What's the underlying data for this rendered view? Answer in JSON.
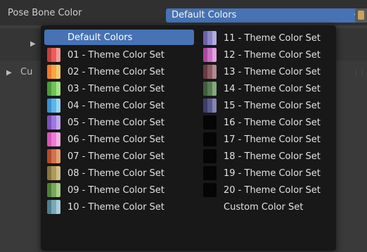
{
  "property": {
    "label": "Pose Bone Color",
    "value": "Default Colors"
  },
  "menu": {
    "left_items": [
      {
        "label": "Default Colors",
        "swatch": null,
        "selected": true
      },
      {
        "label": "01 - Theme Color Set",
        "swatch": [
          "#c0413f",
          "#f05c56",
          "#f29c9c"
        ]
      },
      {
        "label": "02 - Theme Color Set",
        "swatch": [
          "#f07a2a",
          "#f7a643",
          "#f6cc6a"
        ]
      },
      {
        "label": "03 - Theme Color Set",
        "swatch": [
          "#4a9b3a",
          "#6ec35a",
          "#a6e57e"
        ]
      },
      {
        "label": "04 - Theme Color Set",
        "swatch": [
          "#3a8fd0",
          "#5cb6e8",
          "#9ad7f2"
        ]
      },
      {
        "label": "05 - Theme Color Set",
        "swatch": [
          "#7a52b8",
          "#9e78dc",
          "#c4a8ee"
        ]
      },
      {
        "label": "06 - Theme Color Set",
        "swatch": [
          "#d655b8",
          "#ee7cd4",
          "#f6b0e6"
        ]
      },
      {
        "label": "07 - Theme Color Set",
        "swatch": [
          "#b24a2c",
          "#d0744c",
          "#e8a070"
        ]
      },
      {
        "label": "08 - Theme Color Set",
        "swatch": [
          "#8a7440",
          "#b09a58",
          "#d0c08a"
        ]
      },
      {
        "label": "09 - Theme Color Set",
        "swatch": [
          "#4f7e3a",
          "#7aa85a",
          "#a6cf86"
        ]
      },
      {
        "label": "10 - Theme Color Set",
        "swatch": [
          "#4f7e8e",
          "#7aa8b6",
          "#a6cfdb"
        ]
      }
    ],
    "right_items": [
      {
        "label": "11 - Theme Color Set",
        "swatch": [
          "#6a62a8",
          "#8c84c8",
          "#b2acde"
        ]
      },
      {
        "label": "12 - Theme Color Set",
        "swatch": [
          "#a64aa0",
          "#cc70c4",
          "#e2a2dc"
        ]
      },
      {
        "label": "13 - Theme Color Set",
        "swatch": [
          "#6a3a42",
          "#8c5c64",
          "#b08a90"
        ]
      },
      {
        "label": "14 - Theme Color Set",
        "swatch": [
          "#3f5e3a",
          "#5a7c54",
          "#86a67e"
        ]
      },
      {
        "label": "15 - Theme Color Set",
        "swatch": [
          "#3e3e6a",
          "#5a5a8c",
          "#8484b2"
        ]
      },
      {
        "label": "16 - Theme Color Set",
        "swatch": [
          "#050505",
          "#050505",
          "#050505"
        ]
      },
      {
        "label": "17 - Theme Color Set",
        "swatch": [
          "#050505",
          "#050505",
          "#050505"
        ]
      },
      {
        "label": "18 - Theme Color Set",
        "swatch": [
          "#050505",
          "#050505",
          "#050505"
        ]
      },
      {
        "label": "19 - Theme Color Set",
        "swatch": [
          "#050505",
          "#050505",
          "#050505"
        ]
      },
      {
        "label": "20 - Theme Color Set",
        "swatch": [
          "#050505",
          "#050505",
          "#050505"
        ]
      },
      {
        "label": "Custom Color Set",
        "swatch": null
      }
    ]
  },
  "background": {
    "panel_label_fragment": "Cu"
  },
  "colors": {
    "accent": "#4772b3",
    "menu_bg": "#181818",
    "window_bg": "#3d3d3d"
  },
  "icons": {
    "dropdown": "chevron-down-icon",
    "eyedropper": "eyedropper-icon",
    "expand": "triangle-right-icon"
  }
}
